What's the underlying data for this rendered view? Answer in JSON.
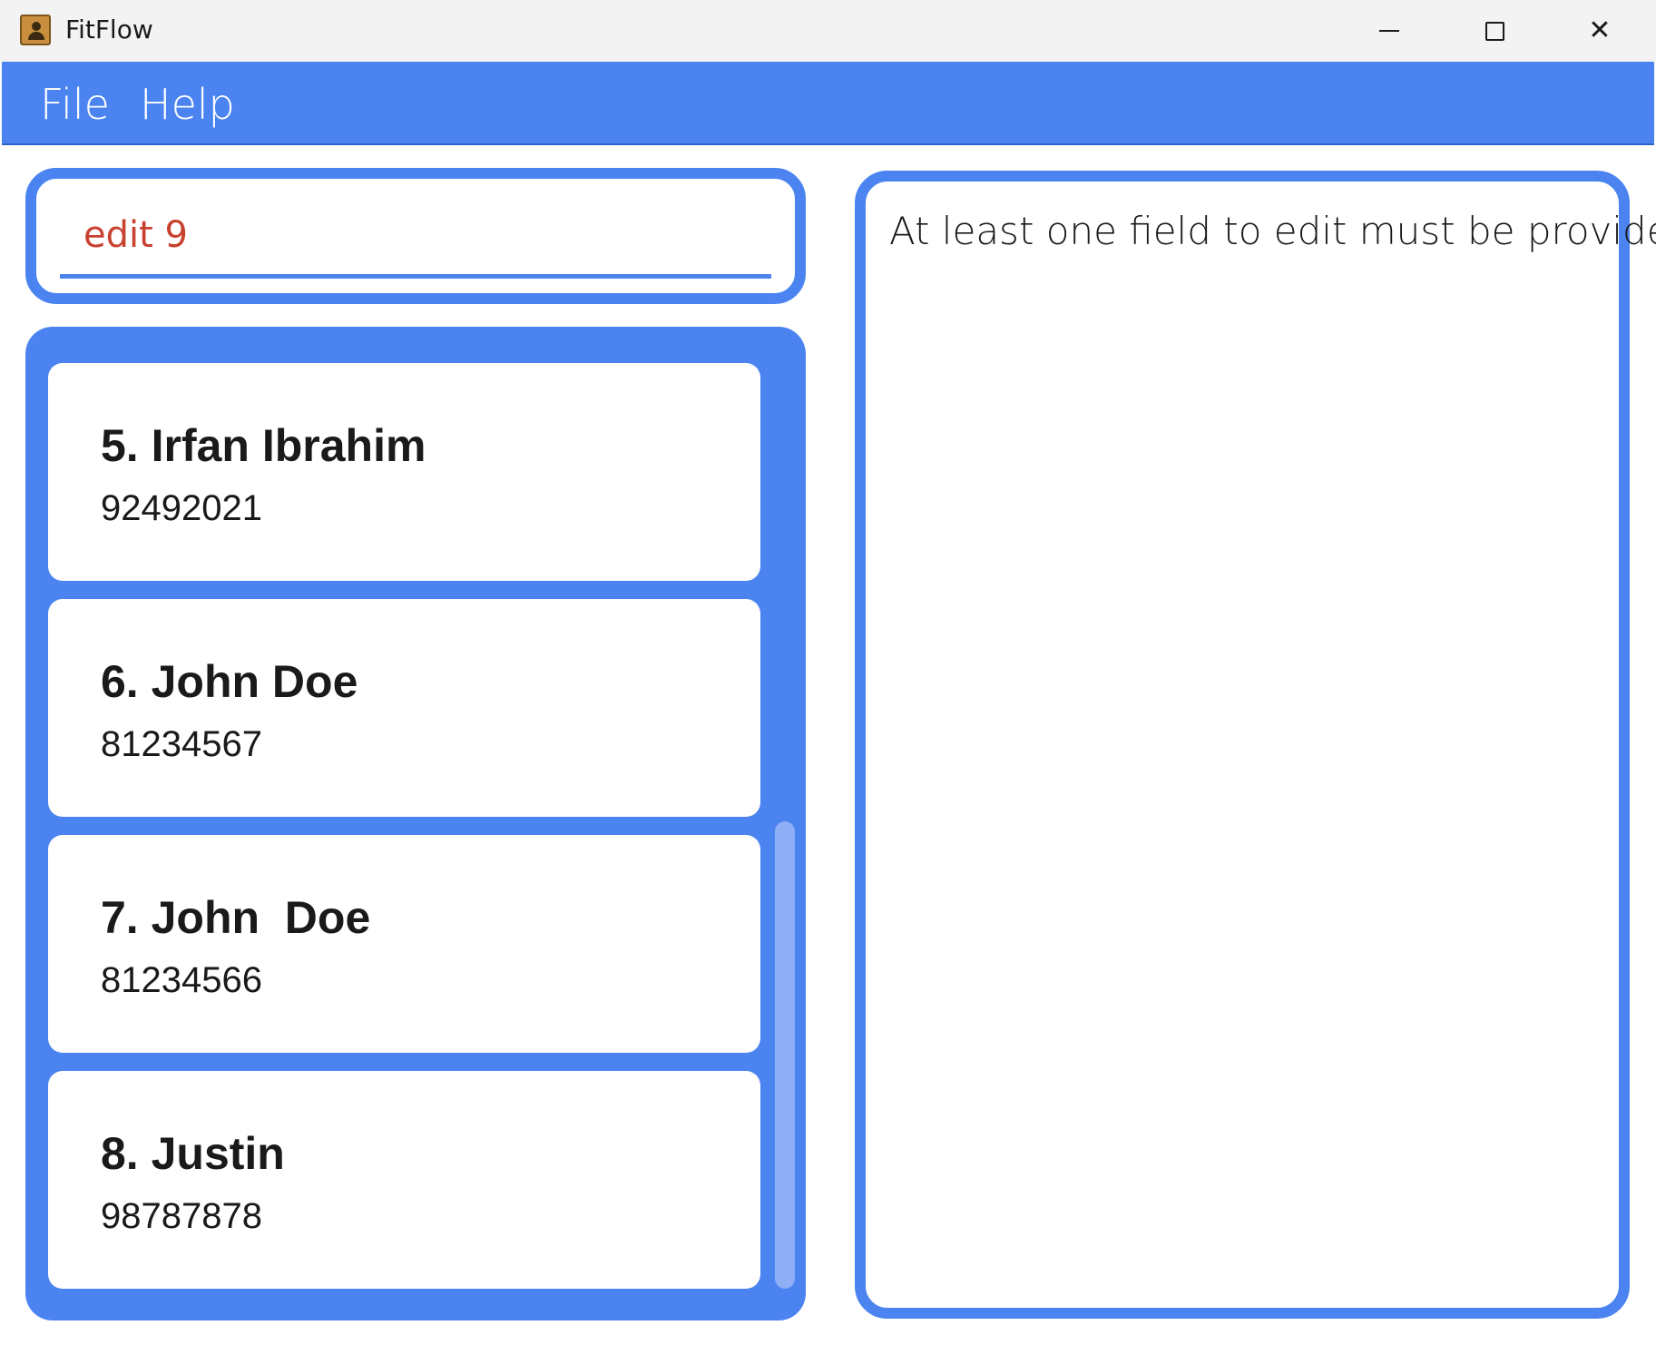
{
  "window": {
    "title": "FitFlow",
    "icons": {
      "app": "address-book-icon",
      "minimize": "minimize-icon",
      "maximize": "maximize-icon",
      "close": "close-icon"
    },
    "close_glyph": "✕"
  },
  "menu": {
    "items": [
      {
        "label": "File"
      },
      {
        "label": "Help"
      }
    ]
  },
  "command": {
    "value": "edit 9"
  },
  "persons": [
    {
      "name": "5. Irfan Ibrahim",
      "phone": "92492021"
    },
    {
      "name": "6. John Doe",
      "phone": "81234567"
    },
    {
      "name": "7. John  Doe",
      "phone": "81234566"
    },
    {
      "name": "8. Justin",
      "phone": "98787878"
    }
  ],
  "result": {
    "message": "At least one field to edit must be provided."
  },
  "colors": {
    "accent": "#4b84f0",
    "command_text": "#c8412f",
    "scrollbar": "#8eaef5"
  }
}
